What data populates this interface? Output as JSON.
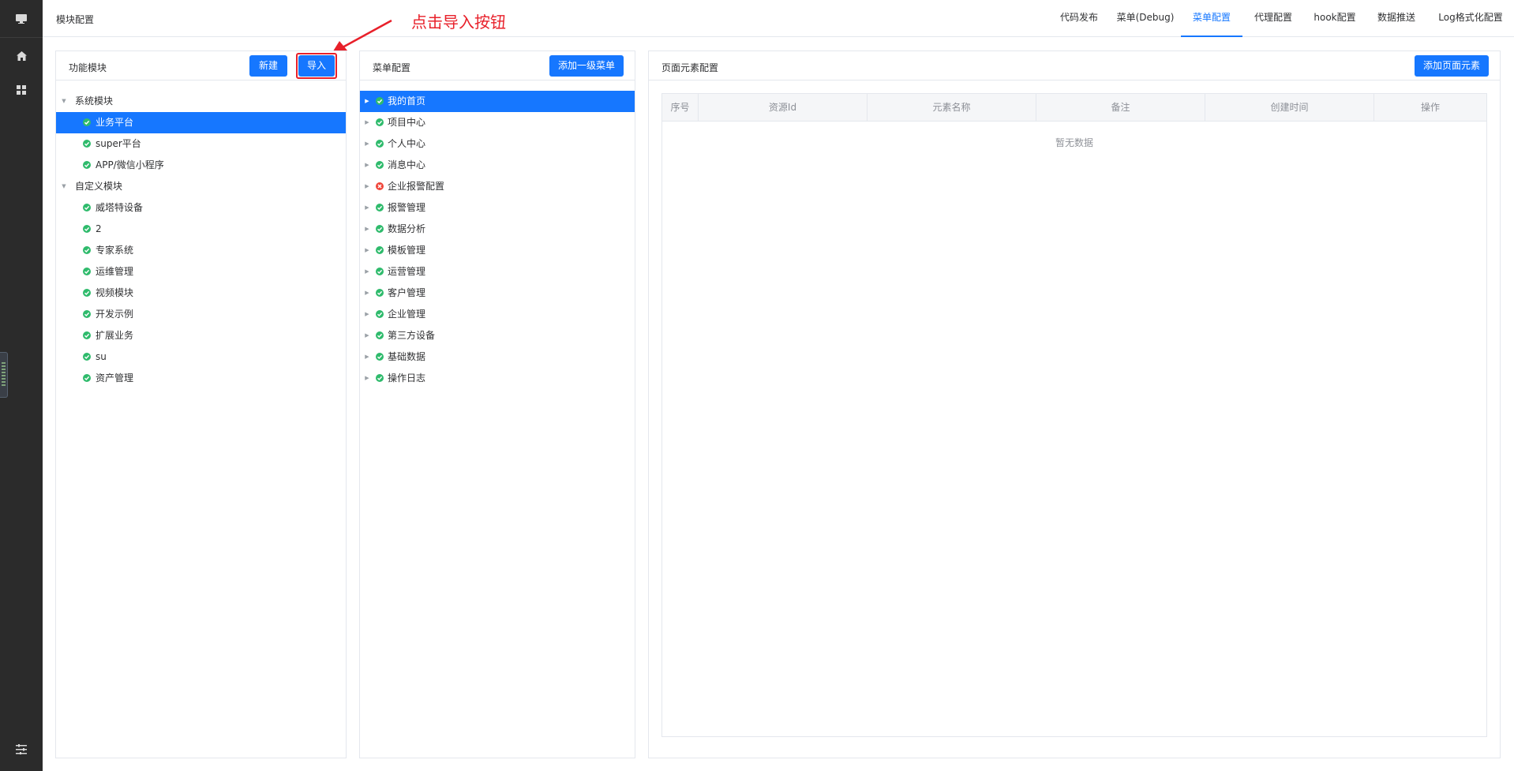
{
  "header": {
    "title": "模块配置",
    "tabs": [
      {
        "label": "代码发布"
      },
      {
        "label": "菜单(Debug)"
      },
      {
        "label": "菜单配置",
        "active": true
      },
      {
        "label": "代理配置"
      },
      {
        "label": "hook配置"
      },
      {
        "label": "数据推送"
      },
      {
        "label": "Log格式化配置"
      }
    ]
  },
  "annotation": {
    "text": "点击导入按钮",
    "color": "#e8202a"
  },
  "modules_panel": {
    "title": "功能模块",
    "new_label": "新建",
    "import_label": "导入",
    "groups": [
      {
        "label": "系统模块",
        "items": [
          {
            "label": "业务平台",
            "selected": true
          },
          {
            "label": "super平台"
          },
          {
            "label": "APP/微信小程序"
          }
        ]
      },
      {
        "label": "自定义模块",
        "items": [
          {
            "label": "威塔特设备"
          },
          {
            "label": "2"
          },
          {
            "label": "专家系统"
          },
          {
            "label": "运维管理"
          },
          {
            "label": "视频模块"
          },
          {
            "label": "开发示例"
          },
          {
            "label": "扩展业务"
          },
          {
            "label": "su"
          },
          {
            "label": "资产管理"
          }
        ]
      }
    ]
  },
  "menu_panel": {
    "title": "菜单配置",
    "add_label": "添加一级菜单",
    "items": [
      {
        "label": "我的首页",
        "status": "ok",
        "selected": true
      },
      {
        "label": "项目中心",
        "status": "ok"
      },
      {
        "label": "个人中心",
        "status": "ok"
      },
      {
        "label": "消息中心",
        "status": "ok"
      },
      {
        "label": "企业报警配置",
        "status": "error"
      },
      {
        "label": "报警管理",
        "status": "ok"
      },
      {
        "label": "数据分析",
        "status": "ok"
      },
      {
        "label": "模板管理",
        "status": "ok"
      },
      {
        "label": "运营管理",
        "status": "ok"
      },
      {
        "label": "客户管理",
        "status": "ok"
      },
      {
        "label": "企业管理",
        "status": "ok"
      },
      {
        "label": "第三方设备",
        "status": "ok"
      },
      {
        "label": "基础数据",
        "status": "ok"
      },
      {
        "label": "操作日志",
        "status": "ok"
      }
    ]
  },
  "elements_panel": {
    "title": "页面元素配置",
    "add_label": "添加页面元素",
    "columns": [
      "序号",
      "资源Id",
      "元素名称",
      "备注",
      "创建时间",
      "操作"
    ],
    "empty_text": "暂无数据"
  },
  "colors": {
    "primary": "#1677ff",
    "ok": "#2fbb6c",
    "error": "#f0453a",
    "annotation": "#e8202a"
  },
  "icons": {
    "rail": [
      "monitor-icon",
      "home-icon",
      "apps-grid-icon",
      "sliders-icon"
    ]
  }
}
